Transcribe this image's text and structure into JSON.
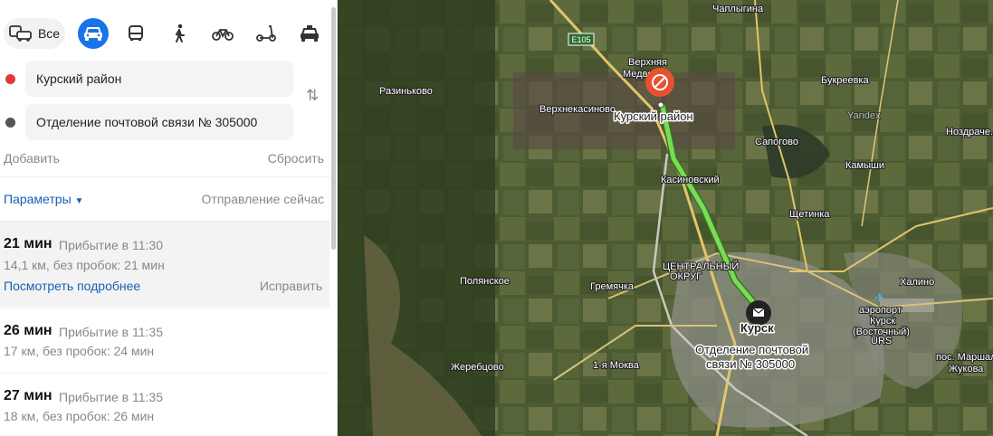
{
  "modes": {
    "all_label": "Все",
    "items": [
      {
        "id": "car",
        "icon": "car-icon",
        "active": true
      },
      {
        "id": "bus",
        "icon": "bus-icon",
        "active": false
      },
      {
        "id": "walk",
        "icon": "walk-icon",
        "active": false
      },
      {
        "id": "bike",
        "icon": "bike-icon",
        "active": false
      },
      {
        "id": "scooter",
        "icon": "scooter-icon",
        "active": false
      },
      {
        "id": "taxi",
        "icon": "taxi-icon",
        "active": false
      }
    ]
  },
  "from": {
    "value": "Курский район",
    "dot_color": "#e03a3a"
  },
  "to": {
    "value": "Отделение почтовой связи № 305000",
    "dot_color": "#555555"
  },
  "actions": {
    "add": "Добавить",
    "reset": "Сбросить"
  },
  "params": {
    "label": "Параметры",
    "departure": "Отправление сейчас"
  },
  "routes": [
    {
      "time": "21 мин",
      "arrival": "Прибытие в 11:30",
      "distance": "14,1 км, без пробок: 21 мин",
      "details": "Посмотреть подробнее",
      "fix": "Исправить",
      "selected": true
    },
    {
      "time": "26 мин",
      "arrival": "Прибытие в 11:35",
      "distance": "17 км, без пробок: 24 мин"
    },
    {
      "time": "27 мин",
      "arrival": "Прибытие в 11:35",
      "distance": "18 км, без пробок: 26 мин"
    }
  ],
  "map": {
    "road_shield": "E105",
    "watermark": "Yandex",
    "places": {
      "chaplygina": "Чаплыгина",
      "verkhnyaya_medvedi": "Верхняя\nМедведи...",
      "razinkovo": "Разиньково",
      "bukreevka": "Букреевка",
      "verkhnekasinovo": "Верхнекасиново",
      "sapogovo": "Сапогово",
      "nozdrachevo": "Ноздраче...",
      "kamyshi": "Камыши",
      "kasinovsky": "Касиновский",
      "shchetinka": "Щетинка",
      "tsentralny_okrug": "ЦЕНТРАЛЬНЫЙ\nОКРУГ",
      "polyanskoe": "Полянское",
      "gremyachka": "Гремячка",
      "khalino": "Халино",
      "airport": "аэропорт\nКурск\n(Восточный)",
      "urs": "URS",
      "kursk": "Курск",
      "zherebtsovo": "Жеребцово",
      "mokva": "1-я Моква",
      "pos_marshala": "пос. Маршала\nЖукова"
    },
    "start_label": "Курский район",
    "end_label": "Отделение почтовой\nсвязи № 305000",
    "start_color": "#e8512f",
    "route_color": "#7ed957"
  }
}
